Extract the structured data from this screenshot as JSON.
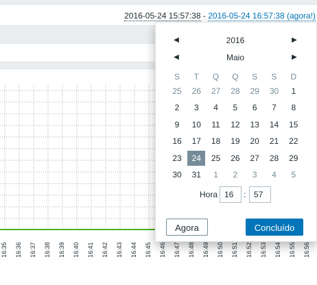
{
  "time_range": {
    "from": "2016-05-24 15:57:38",
    "separator": "-",
    "to": "2016-05-24 16:57:38 (agora!)"
  },
  "graph": {
    "line_color": "#4caf1a",
    "x_tick_labels": [
      "16:35",
      "16:36",
      "16:37",
      "16:38",
      "16:39",
      "16:40",
      "16:41",
      "16:42",
      "16:43",
      "16:44",
      "16:45",
      "16:46",
      "16:47",
      "16:48",
      "16:49",
      "16:50",
      "16:51",
      "16:52",
      "16:53",
      "16:54",
      "16:55",
      "16:56"
    ]
  },
  "calendar": {
    "year": "2016",
    "month": "Maio",
    "prev_icon": "left-triangle-icon",
    "next_icon": "right-triangle-icon",
    "weekdays": [
      "S",
      "T",
      "Q",
      "Q",
      "S",
      "S",
      "D"
    ],
    "weeks": [
      [
        {
          "d": "25",
          "o": true
        },
        {
          "d": "26",
          "o": true
        },
        {
          "d": "27",
          "o": true
        },
        {
          "d": "28",
          "o": true
        },
        {
          "d": "29",
          "o": true
        },
        {
          "d": "30",
          "o": true
        },
        {
          "d": "1"
        }
      ],
      [
        {
          "d": "2"
        },
        {
          "d": "3"
        },
        {
          "d": "4"
        },
        {
          "d": "5"
        },
        {
          "d": "6"
        },
        {
          "d": "7"
        },
        {
          "d": "8"
        }
      ],
      [
        {
          "d": "9"
        },
        {
          "d": "10"
        },
        {
          "d": "11"
        },
        {
          "d": "12"
        },
        {
          "d": "13"
        },
        {
          "d": "14"
        },
        {
          "d": "15"
        }
      ],
      [
        {
          "d": "16"
        },
        {
          "d": "17"
        },
        {
          "d": "18"
        },
        {
          "d": "19"
        },
        {
          "d": "20"
        },
        {
          "d": "21"
        },
        {
          "d": "22"
        }
      ],
      [
        {
          "d": "23"
        },
        {
          "d": "24",
          "sel": true
        },
        {
          "d": "25"
        },
        {
          "d": "26"
        },
        {
          "d": "27"
        },
        {
          "d": "28"
        },
        {
          "d": "29"
        }
      ],
      [
        {
          "d": "30"
        },
        {
          "d": "31"
        },
        {
          "d": "1",
          "o": true
        },
        {
          "d": "2",
          "o": true
        },
        {
          "d": "3",
          "o": true
        },
        {
          "d": "4",
          "o": true
        },
        {
          "d": "5",
          "o": true
        }
      ]
    ],
    "time_label": "Hora",
    "hour": "16",
    "minute": "57",
    "now_button": "Agora",
    "done_button": "Concluído"
  }
}
